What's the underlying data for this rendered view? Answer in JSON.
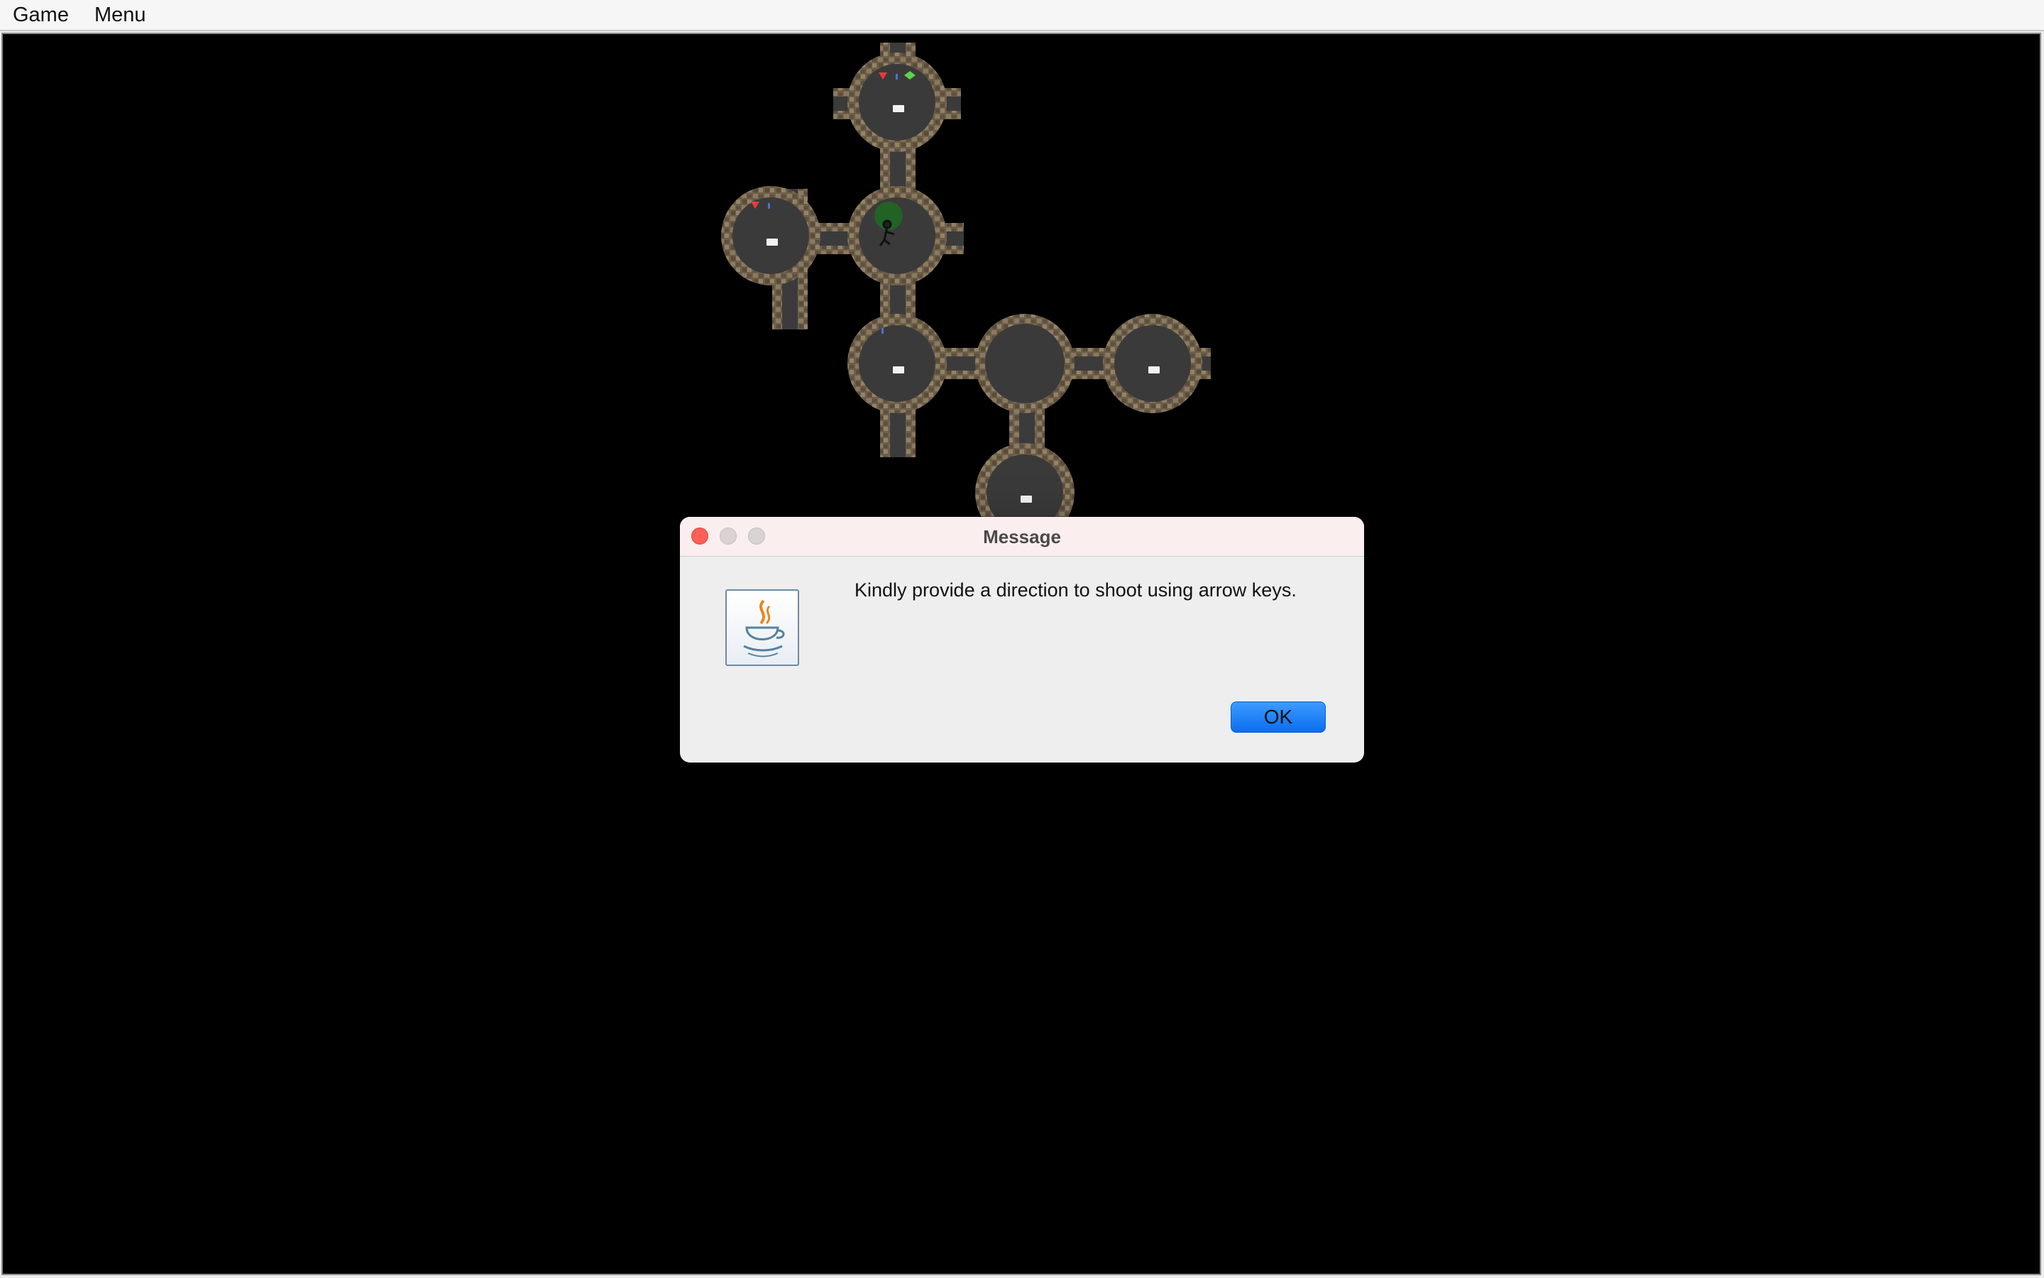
{
  "menubar": {
    "items": [
      {
        "label": "Game"
      },
      {
        "label": "Menu"
      }
    ]
  },
  "dialog": {
    "title": "Message",
    "message": "Kindly provide a direction to shoot using arrow keys.",
    "ok_label": "OK",
    "icon": "java-coffee-cup-icon"
  },
  "game": {
    "background_color": "#000000",
    "cave_floor_color": "#3a3a3a",
    "cave_wall_color": "#7a6a52",
    "items_shown": [
      "red-gem-icon",
      "green-gem-icon",
      "arrow-icon",
      "bed-icon",
      "player-sprite",
      "green-smell-aura"
    ]
  },
  "colors": {
    "ok_button": "#0a6ef0",
    "close_button": "#fe5f57",
    "dialog_titlebar": "#fbeeee"
  }
}
